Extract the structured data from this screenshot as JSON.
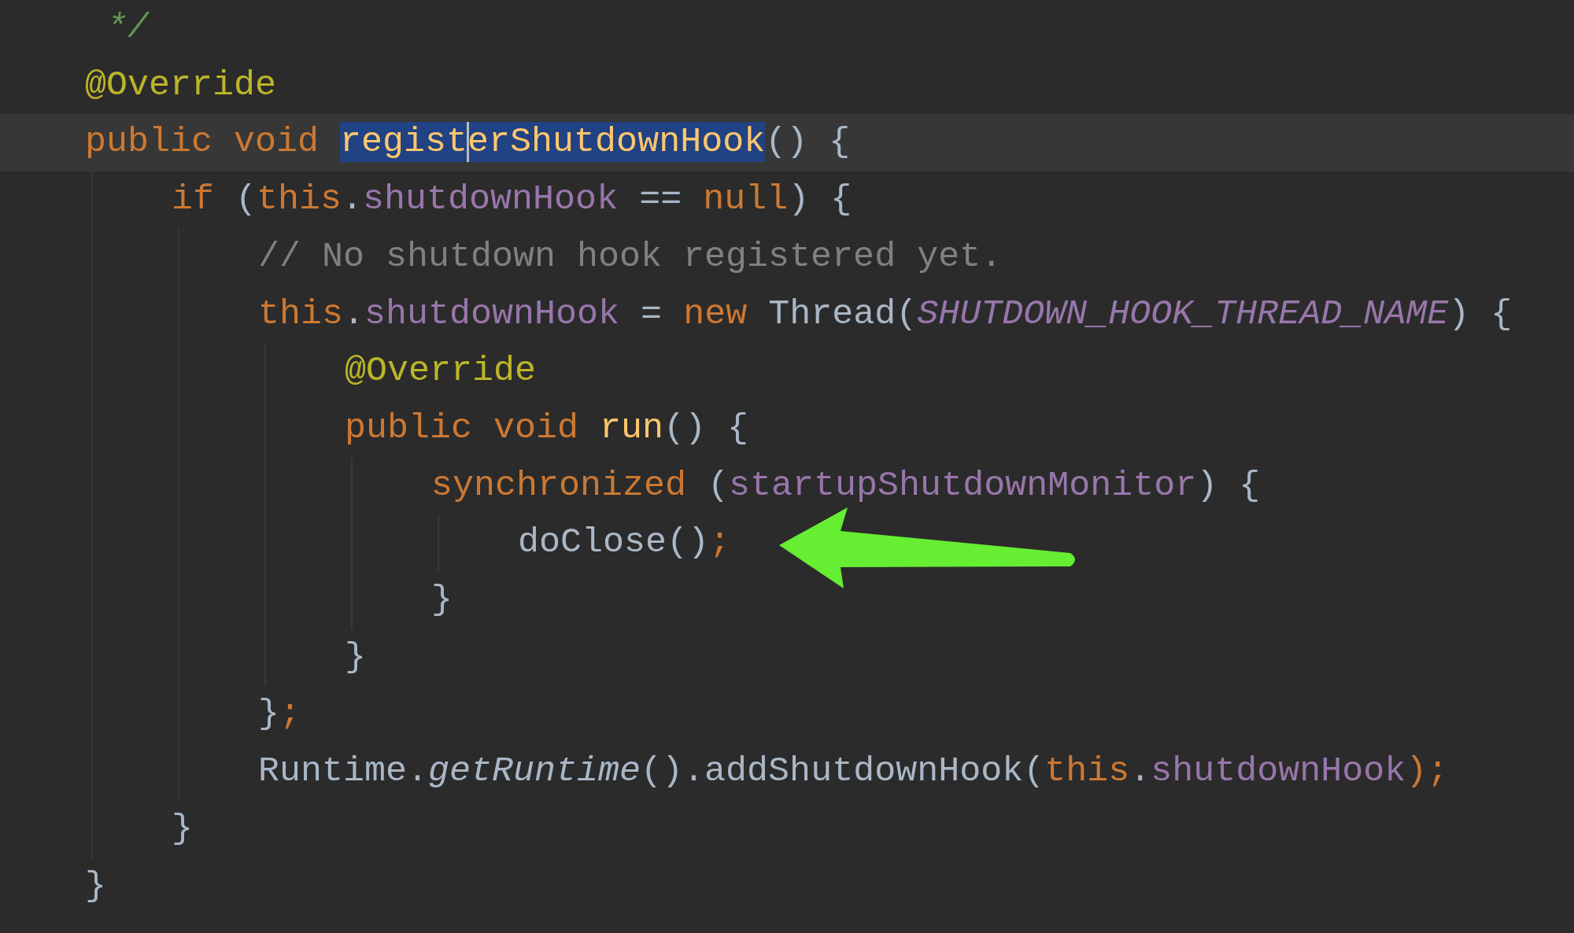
{
  "editor": {
    "lines": [
      {
        "tokens": [
          {
            "text": " */",
            "kind": "doc"
          }
        ]
      },
      {
        "tokens": [
          {
            "text": "@Override",
            "kind": "annotation"
          }
        ]
      },
      {
        "current": true,
        "tokens": [
          {
            "text": "public void ",
            "kind": "keyword"
          },
          {
            "text": "regist",
            "kind": "method",
            "selected": true
          },
          {
            "text": "erShutdownHook",
            "kind": "method",
            "selected": true,
            "caret": true
          },
          {
            "text": "() {",
            "kind": "plain"
          }
        ],
        "children": [
          {
            "tokens": [
              {
                "text": "if ",
                "kind": "keyword"
              },
              {
                "text": "(",
                "kind": "plain"
              },
              {
                "text": "this",
                "kind": "keyword"
              },
              {
                "text": ".",
                "kind": "plain"
              },
              {
                "text": "shutdownHook",
                "kind": "field"
              },
              {
                "text": " == ",
                "kind": "plain"
              },
              {
                "text": "null",
                "kind": "keyword"
              },
              {
                "text": ") {",
                "kind": "plain"
              }
            ],
            "children": [
              {
                "tokens": [
                  {
                    "text": "// No shutdown hook registered yet.",
                    "kind": "comment"
                  }
                ]
              },
              {
                "tokens": [
                  {
                    "text": "this",
                    "kind": "keyword"
                  },
                  {
                    "text": ".",
                    "kind": "plain"
                  },
                  {
                    "text": "shutdownHook",
                    "kind": "field"
                  },
                  {
                    "text": " = ",
                    "kind": "plain"
                  },
                  {
                    "text": "new ",
                    "kind": "keyword"
                  },
                  {
                    "text": "Thread(",
                    "kind": "plain"
                  },
                  {
                    "text": "SHUTDOWN_HOOK_THREAD_NAME",
                    "kind": "constant"
                  },
                  {
                    "text": ") {",
                    "kind": "plain"
                  }
                ],
                "children": [
                  {
                    "tokens": [
                      {
                        "text": "@Override",
                        "kind": "annotation"
                      }
                    ]
                  },
                  {
                    "tokens": [
                      {
                        "text": "public void ",
                        "kind": "keyword"
                      },
                      {
                        "text": "run",
                        "kind": "method"
                      },
                      {
                        "text": "() {",
                        "kind": "plain"
                      }
                    ],
                    "children": [
                      {
                        "tokens": [
                          {
                            "text": "synchronized ",
                            "kind": "keyword"
                          },
                          {
                            "text": "(",
                            "kind": "plain"
                          },
                          {
                            "text": "startupShutdownMonitor",
                            "kind": "field"
                          },
                          {
                            "text": ") {",
                            "kind": "plain"
                          }
                        ],
                        "children": [
                          {
                            "tokens": [
                              {
                                "text": "doClose()",
                                "kind": "plain"
                              },
                              {
                                "text": ";",
                                "kind": "keyword"
                              }
                            ]
                          }
                        ],
                        "end": [
                          {
                            "text": "}",
                            "kind": "plain"
                          }
                        ]
                      }
                    ],
                    "end": [
                      {
                        "text": "}",
                        "kind": "plain"
                      }
                    ]
                  }
                ],
                "end": [
                  {
                    "text": "}",
                    "kind": "plain"
                  },
                  {
                    "text": ";",
                    "kind": "keyword"
                  }
                ]
              },
              {
                "tokens": [
                  {
                    "text": "Runtime.",
                    "kind": "plain"
                  },
                  {
                    "text": "getRuntime",
                    "kind": "static"
                  },
                  {
                    "text": "().addShutdownHook(",
                    "kind": "plain"
                  },
                  {
                    "text": "this",
                    "kind": "keyword"
                  },
                  {
                    "text": ".",
                    "kind": "plain"
                  },
                  {
                    "text": "shutdownHook",
                    "kind": "field"
                  },
                  {
                    "text": ");",
                    "kind": "keyword"
                  }
                ]
              }
            ],
            "end": [
              {
                "text": "}",
                "kind": "plain"
              }
            ]
          }
        ],
        "end": [
          {
            "text": "}",
            "kind": "plain"
          }
        ]
      }
    ]
  }
}
